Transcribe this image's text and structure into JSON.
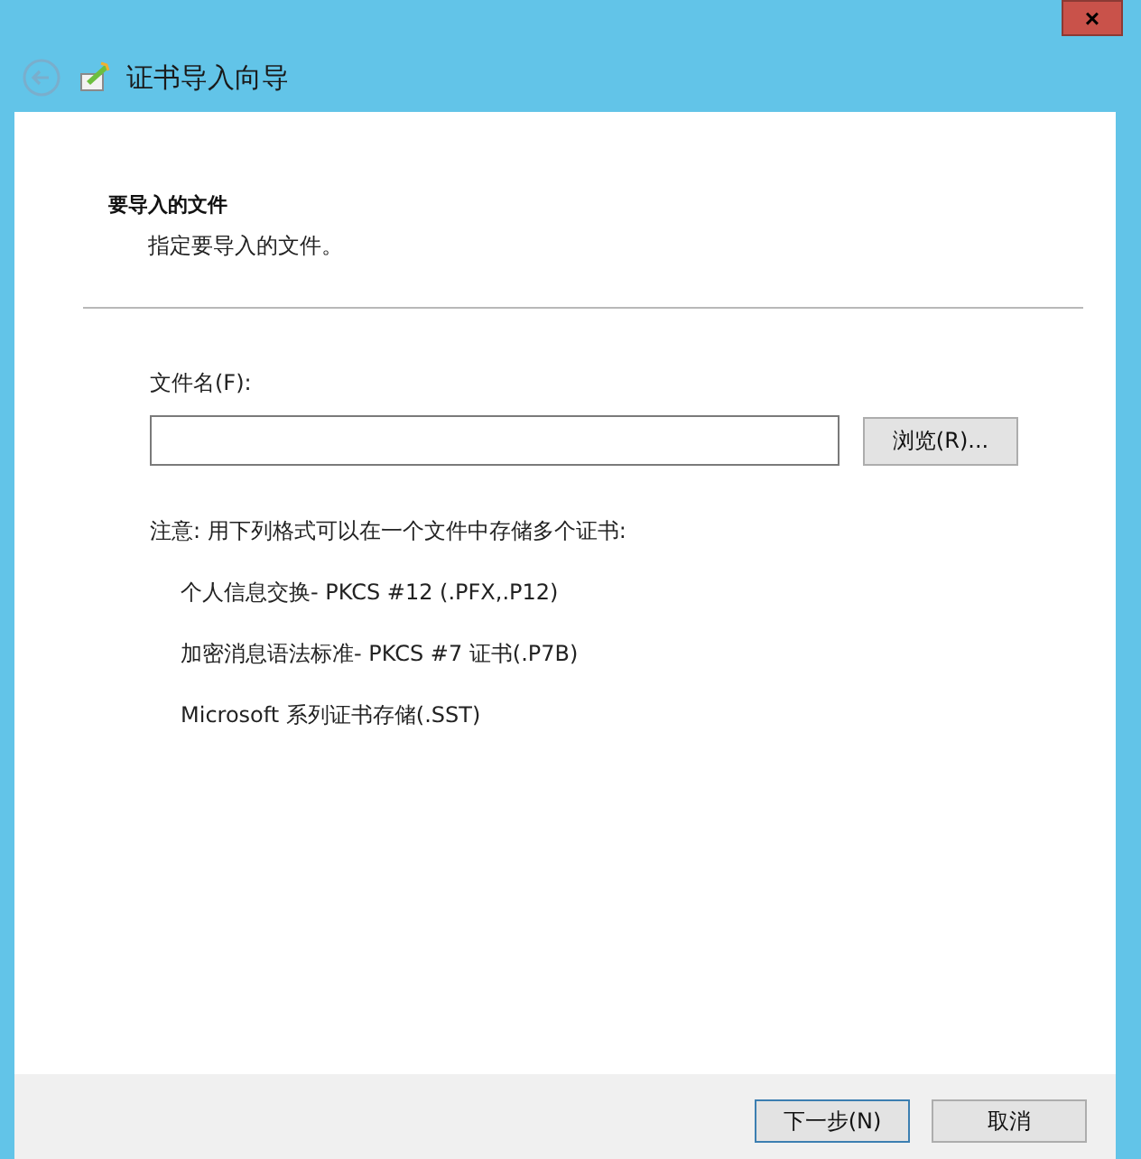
{
  "window": {
    "title": "证书导入向导",
    "close": "×"
  },
  "header": {
    "heading": "要导入的文件",
    "subtitle": "指定要导入的文件。"
  },
  "file_field": {
    "label": "文件名(F):",
    "browse": "浏览(R)..."
  },
  "note": "注意: 用下列格式可以在一个文件中存储多个证书:",
  "formats": [
    "个人信息交换- PKCS #12 (.PFX,.P12)",
    "加密消息语法标准- PKCS #7 证书(.P7B)",
    "Microsoft 系列证书存储(.SST)"
  ],
  "buttons": [
    {
      "label": "下一步(N)",
      "kind": "primary"
    },
    {
      "label": "取消",
      "kind": "cancel"
    }
  ]
}
